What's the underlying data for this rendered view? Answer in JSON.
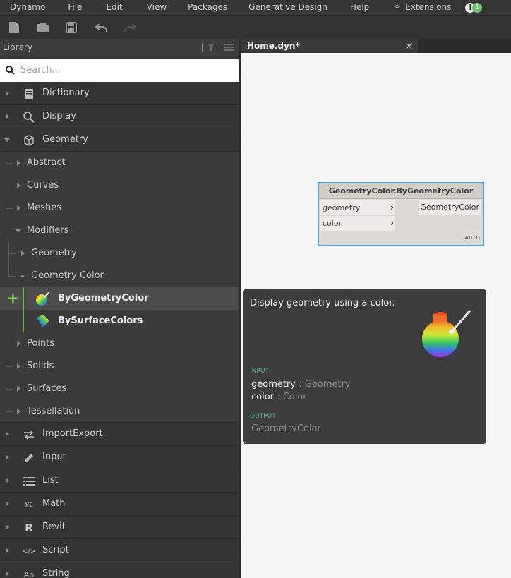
{
  "menubar": {
    "items": [
      "Dynamo",
      "File",
      "Edit",
      "View",
      "Packages",
      "Generative Design",
      "Help",
      "Extensions"
    ],
    "notification_count": "1"
  },
  "toolbar": {
    "buttons": [
      "new-file-icon",
      "open-file-icon",
      "save-icon",
      "undo-icon",
      "redo-icon"
    ]
  },
  "library": {
    "title": "Library",
    "search_placeholder": "Search...",
    "categories_top": [
      {
        "label": "Dictionary",
        "icon": "dictionary-icon"
      },
      {
        "label": "Display",
        "icon": "magnifier-icon"
      },
      {
        "label": "Geometry",
        "icon": "cube-icon",
        "expanded": true
      }
    ],
    "geometry_children": [
      {
        "label": "Abstract"
      },
      {
        "label": "Curves"
      },
      {
        "label": "Meshes"
      },
      {
        "label": "Modifiers",
        "expanded": true
      }
    ],
    "modifiers_children": [
      {
        "label": "Geometry"
      },
      {
        "label": "Geometry Color",
        "expanded": true
      }
    ],
    "members": [
      {
        "label": "ByGeometryColor",
        "selected": true
      },
      {
        "label": "BySurfaceColors",
        "selected": false
      }
    ],
    "geometry_children_after": [
      {
        "label": "Points"
      },
      {
        "label": "Solids"
      },
      {
        "label": "Surfaces"
      },
      {
        "label": "Tessellation"
      }
    ],
    "categories_bottom": [
      {
        "label": "ImportExport",
        "icon": "import-export-icon"
      },
      {
        "label": "Input",
        "icon": "pencil-icon"
      },
      {
        "label": "List",
        "icon": "list-icon"
      },
      {
        "label": "Math",
        "icon": "superscript-icon"
      },
      {
        "label": "Revit",
        "icon": "revit-icon"
      },
      {
        "label": "Script",
        "icon": "code-icon"
      },
      {
        "label": "String",
        "icon": "text-icon"
      }
    ],
    "add_glyph": "+"
  },
  "workspace": {
    "tab_label": "Home.dyn*",
    "tab_close": "×"
  },
  "node": {
    "title": "GeometryColor.ByGeometryColor",
    "inputs": [
      "geometry",
      "color"
    ],
    "output": "GeometryColor",
    "lacing": "AUTO"
  },
  "tooltip": {
    "description": "Display geometry using a color.",
    "input_header": "INPUT",
    "params": [
      {
        "name": "geometry",
        "type": ": Geometry"
      },
      {
        "name": "color",
        "type": ": Color"
      }
    ],
    "output_header": "OUTPUT",
    "output": "GeometryColor"
  },
  "colors": {
    "accent_green": "#6fc26d",
    "node_border": "#5a9bd5",
    "tooltip_section": "#5cbf95"
  }
}
